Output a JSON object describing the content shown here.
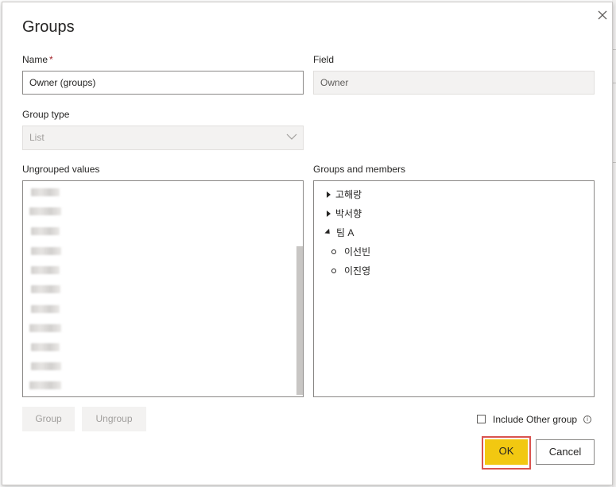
{
  "dialog": {
    "title": "Groups",
    "close_icon": "close-icon"
  },
  "form": {
    "name_label": "Name",
    "required_marker": "*",
    "name_value": "Owner (groups)",
    "field_label": "Field",
    "field_value": "Owner",
    "group_type_label": "Group type",
    "group_type_value": "List",
    "ungrouped_label": "Ungrouped values",
    "groups_label": "Groups and members"
  },
  "tree": [
    {
      "label": "고해랑",
      "state": "collapsed"
    },
    {
      "label": "박서향",
      "state": "collapsed"
    },
    {
      "label": "팀 A",
      "state": "expanded"
    },
    {
      "label": "이선빈",
      "state": "member"
    },
    {
      "label": "이진영",
      "state": "member"
    }
  ],
  "buttons": {
    "group": "Group",
    "ungroup": "Ungroup",
    "include_other": "Include Other group",
    "ok": "OK",
    "cancel": "Cancel"
  },
  "colors": {
    "ok_accent": "#f2c811",
    "highlight": "#d9534f"
  }
}
